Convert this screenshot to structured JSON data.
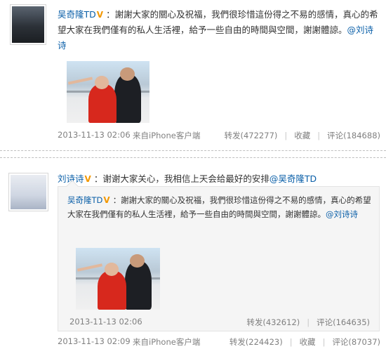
{
  "post1": {
    "username": "吴奇隆TD",
    "text": "：謝謝大家的關心及祝福，我們很珍惜這份得之不易的感情，真心的希望大家在我們僅有的私人生活裡，給予一些自由的時間與空間，謝謝體諒。",
    "mention": "@刘诗诗",
    "time": "2013-11-13 02:06",
    "source_prefix": "来自",
    "source": "iPhone客户端",
    "forward": "转发(472277)",
    "favorite": "收藏",
    "comment": "评论(184688)"
  },
  "post2": {
    "username": "刘诗诗",
    "text": "：谢谢大家关心，我相信上天会给最好的安排",
    "mention": "@吴奇隆TD",
    "time": "2013-11-13 02:09",
    "source_prefix": "来自",
    "source": "iPhone客户端",
    "forward": "转发(224423)",
    "favorite": "收藏",
    "comment": "评论(87037)"
  },
  "quoted": {
    "username": "吴奇隆TD",
    "text": "：謝謝大家的關心及祝福，我們很珍惜這份得之不易的感情，真心的希望大家在我們僅有的私人生活裡，給予一些自由的時間與空間，謝謝體諒。",
    "mention": "@刘诗诗",
    "time": "2013-11-13 02:06",
    "forward": "转发(432612)",
    "comment": "评论(164635)"
  },
  "verified_mark": "V",
  "separator": "|",
  "icons": {
    "verified": "verified-badge-icon"
  },
  "colors": {
    "link": "#0a5fa8",
    "verified": "#f39800",
    "meta": "#808080",
    "quote_bg": "#f5f5f5"
  }
}
